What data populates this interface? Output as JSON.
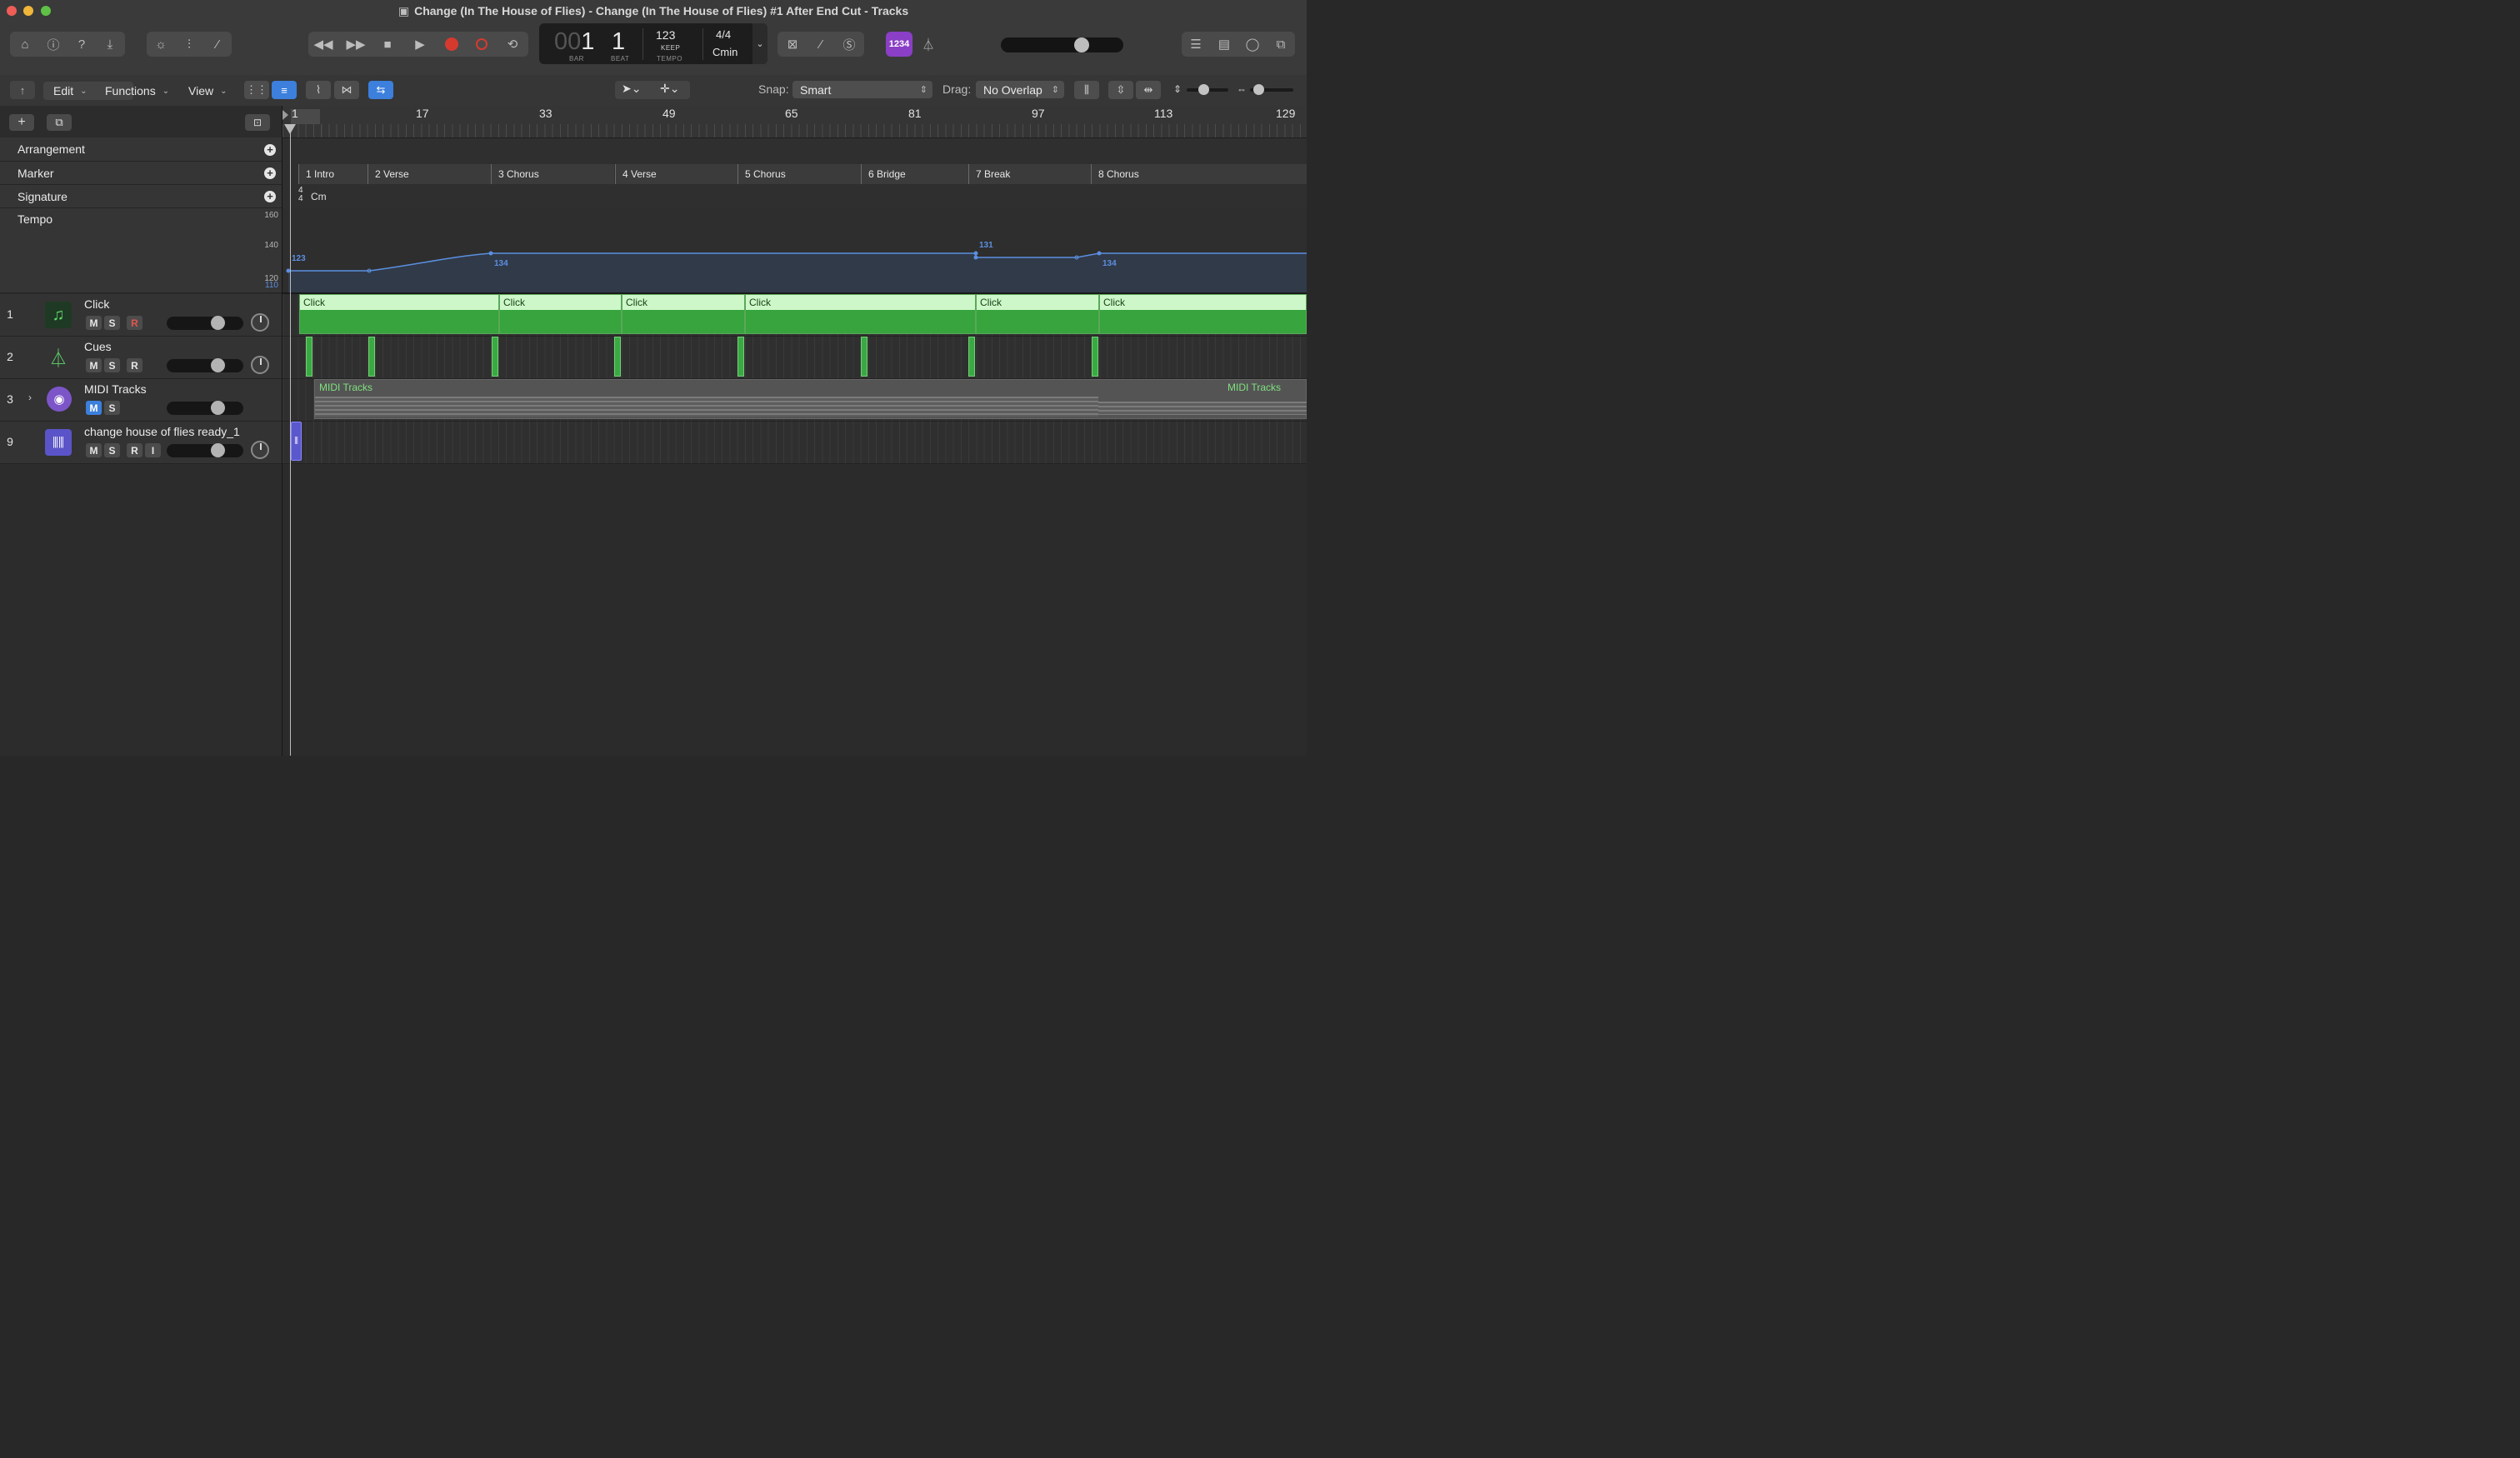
{
  "window": {
    "title": "Change (In The House of Flies) - Change (In The House of Flies) #1 After End Cut - Tracks"
  },
  "lcd": {
    "bar_prefix": "00",
    "bar": "1",
    "beat": "1",
    "bar_label": "BAR",
    "beat_label": "BEAT",
    "tempo": "123",
    "tempo_mode": "KEEP",
    "tempo_label": "TEMPO",
    "signature": "4/4",
    "key": "Cmin"
  },
  "count_in_label": "1234",
  "master_volume": 0.68,
  "toolbar2": {
    "edit": "Edit",
    "functions": "Functions",
    "view": "View",
    "snap_label": "Snap:",
    "snap_value": "Smart",
    "drag_label": "Drag:",
    "drag_value": "No Overlap"
  },
  "ruler": [
    "1",
    "17",
    "33",
    "49",
    "65",
    "81",
    "97",
    "113",
    "129"
  ],
  "global_tracks": {
    "arrangement": "Arrangement",
    "marker": "Marker",
    "signature": "Signature",
    "tempo": "Tempo",
    "signature_top": "4",
    "signature_bottom": "4",
    "signature_key": "Cm",
    "tempo_scale": [
      "160",
      "140",
      "120",
      "110"
    ],
    "tempo_points": [
      "123",
      "134",
      "131",
      "134"
    ]
  },
  "markers": [
    "1 Intro",
    "2 Verse",
    "3 Chorus",
    "4 Verse",
    "5 Chorus",
    "6 Bridge",
    "7 Break",
    "8 Chorus"
  ],
  "tracks": [
    {
      "number": "1",
      "name": "Click",
      "buttons": [
        "M",
        "S",
        "R"
      ],
      "icon": "music-note-icon",
      "volume": 0.7
    },
    {
      "number": "2",
      "name": "Cues",
      "buttons": [
        "M",
        "S",
        "R"
      ],
      "icon": "metronome-icon",
      "volume": 0.7
    },
    {
      "number": "3",
      "name": "MIDI Tracks",
      "buttons": [
        "M",
        "S"
      ],
      "icon": "midi-port-icon",
      "volume": 0.7
    },
    {
      "number": "9",
      "name": "change house of flies ready_1",
      "buttons": [
        "M",
        "S",
        "R",
        "I"
      ],
      "icon": "waveform-icon",
      "volume": 0.7
    }
  ],
  "regions": {
    "click_label": "Click",
    "midi_label": "MIDI Tracks"
  },
  "colors": {
    "click_region": "#b5ecb1",
    "cue_region": "#3aa943",
    "tempo_line": "#5b8fe0",
    "record": "#d63a2f",
    "count_in": "#8a3fc6"
  }
}
